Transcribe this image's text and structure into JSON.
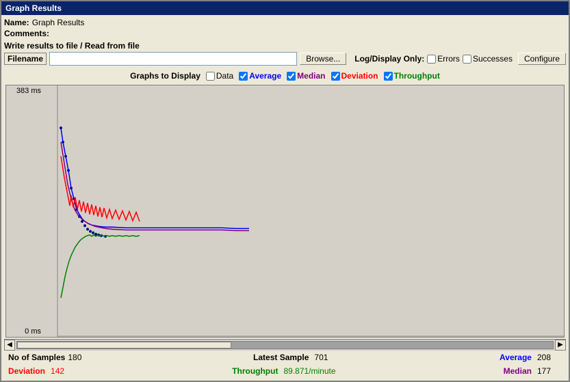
{
  "window": {
    "title": "Graph Results"
  },
  "form": {
    "name_label": "Name:",
    "name_value": "Graph Results",
    "comments_label": "Comments:",
    "write_label": "Write results to file / Read from file",
    "filename_label": "Filename",
    "filename_placeholder": "",
    "browse_label": "Browse...",
    "log_display_label": "Log/Display Only:",
    "errors_label": "Errors",
    "successes_label": "Successes",
    "configure_label": "Configure"
  },
  "graphs": {
    "label": "Graphs to Display",
    "data_label": "Data",
    "average_label": "Average",
    "median_label": "Median",
    "deviation_label": "Deviation",
    "throughput_label": "Throughput",
    "average_checked": true,
    "median_checked": true,
    "deviation_checked": true,
    "throughput_checked": true,
    "data_checked": false
  },
  "chart": {
    "y_top": "383 ms",
    "y_bottom": "0 ms"
  },
  "stats": {
    "no_of_samples_label": "No of Samples",
    "no_of_samples_value": "180",
    "latest_sample_label": "Latest Sample",
    "latest_sample_value": "701",
    "average_label": "Average",
    "average_value": "208",
    "deviation_label": "Deviation",
    "deviation_value": "142",
    "throughput_label": "Throughput",
    "throughput_value": "89.871/minute",
    "median_label": "Median",
    "median_value": "177"
  }
}
